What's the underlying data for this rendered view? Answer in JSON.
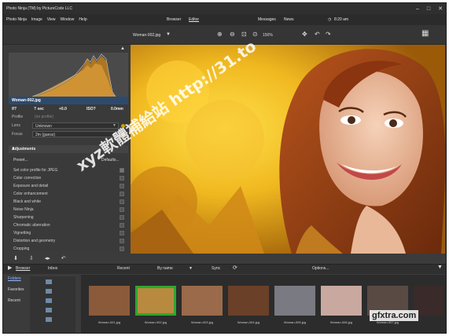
{
  "window": {
    "title": "Photo Ninja (TM) by PictureCode LLC",
    "time": "8:20 am"
  },
  "menu": {
    "items": [
      "Photo Ninja",
      "Image",
      "View",
      "Window",
      "Help"
    ]
  },
  "modes": {
    "browser": "Browser",
    "editor": "Editor",
    "messages": "Messages",
    "news": "News"
  },
  "toolbar": {
    "file_name": "Woman-002.jpg",
    "zoom": "150%"
  },
  "info": {
    "file_name": "Woman-002.jpg",
    "exif": [
      "f/?",
      "? sec",
      "+0.0",
      "ISO?",
      "0.0mm"
    ],
    "profile_label": "Profile",
    "profile_value": "(no profile)",
    "lens_label": "Lens",
    "lens_value": "Unknown",
    "focus_label": "Focus",
    "focus_value": "2m (guess)"
  },
  "adjustments": {
    "title": "Adjustments",
    "preset": "Preset...",
    "defaults": "Defaults...",
    "items": [
      "Set color profile for JPEG",
      "Color correction",
      "Exposure and detail",
      "Color enhancement",
      "Black and white",
      "Noise Ninja",
      "Sharpening",
      "Chromatic aberration",
      "Vignetting",
      "Distortion and geometry",
      "Cropping"
    ]
  },
  "strip": {
    "browser": "Browser",
    "inbox": "Inbox",
    "recent": "Recent",
    "sort": "By name",
    "sync": "Sync",
    "options": "Options..."
  },
  "sidebar": {
    "folders": "Folders",
    "favorites": "Favorites",
    "recent": "Recent"
  },
  "thumbnails": [
    "Woman-001.jpg",
    "Woman-002.jpg",
    "Woman-003.jpg",
    "Woman-004.jpg",
    "Woman-005.jpg",
    "Woman-006.jpg",
    "Woman-007.jpg"
  ],
  "watermarks": {
    "main": "xyz軟體補給站 http://31.to",
    "corner": "gfxtra.com"
  }
}
